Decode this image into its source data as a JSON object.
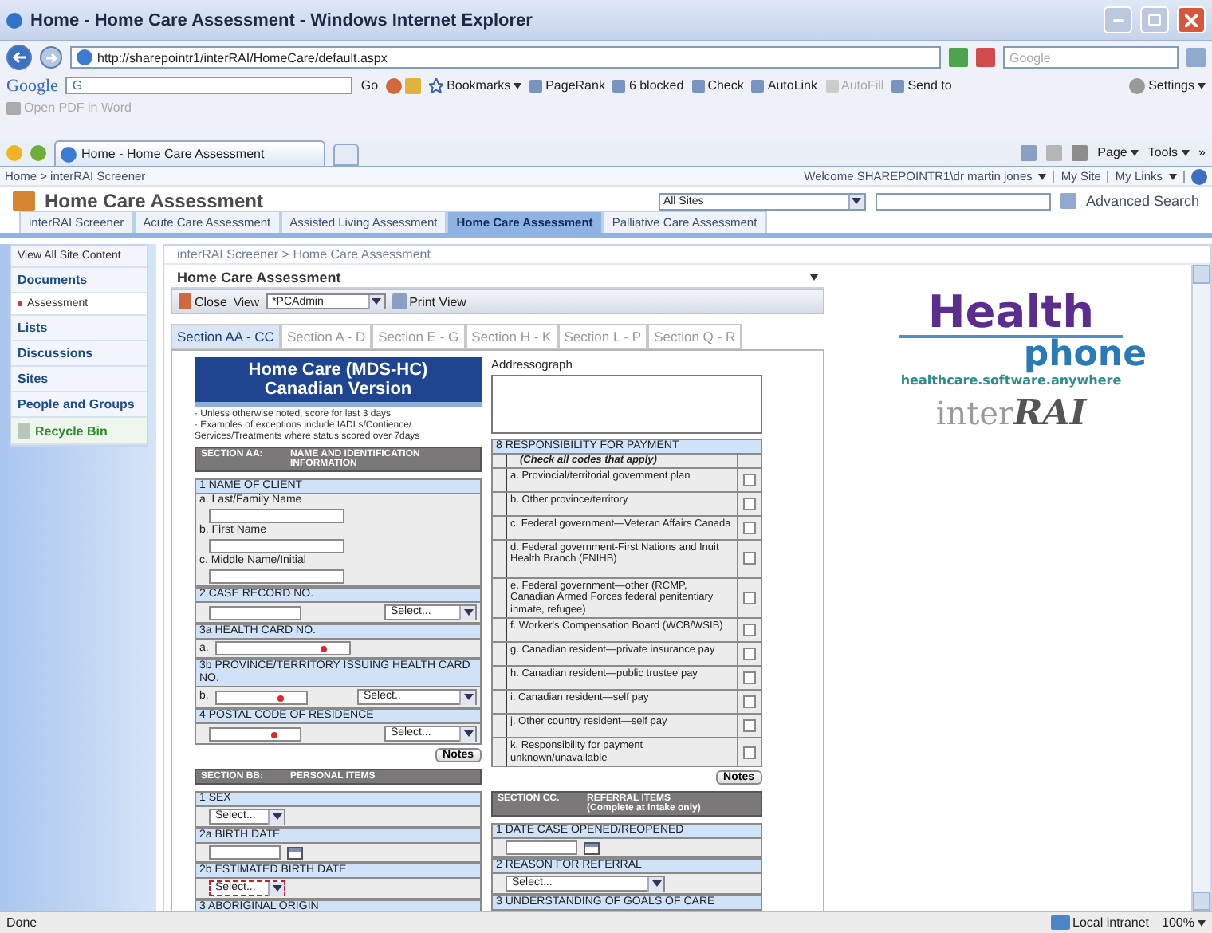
{
  "window": {
    "title": "Home - Home Care Assessment - Windows Internet Explorer"
  },
  "address_bar": {
    "url": "http://sharepointr1/interRAI/HomeCare/default.aspx",
    "search_placeholder": "Google"
  },
  "google_toolbar": {
    "logo": "Google",
    "field_logo": "G",
    "items": [
      {
        "kind": "text",
        "label": "Go",
        "disabled": false
      },
      {
        "kind": "icons",
        "disabled": false
      },
      {
        "kind": "menu",
        "label": "Bookmarks",
        "disabled": false
      },
      {
        "kind": "pagerank",
        "label": "PageRank",
        "disabled": false
      },
      {
        "kind": "blocked",
        "label": "6 blocked",
        "disabled": false
      },
      {
        "kind": "check",
        "label": "Check",
        "disabled": false
      },
      {
        "kind": "autolink",
        "label": "AutoLink",
        "disabled": false
      },
      {
        "kind": "autofill",
        "label": "AutoFill",
        "disabled": true
      },
      {
        "kind": "send",
        "label": "Send to",
        "disabled": false
      }
    ],
    "settings": "Settings"
  },
  "pdf_toolbar": {
    "label": "Open PDF in Word"
  },
  "browser_tab": {
    "title": "Home - Home Care Assessment"
  },
  "command_bar": {
    "page": "Page",
    "tools": "Tools",
    "overflow": "»"
  },
  "site": {
    "breadcrumb": "Home > interRAI Screener",
    "welcome": "Welcome SHAREPOINTR1\\dr martin jones",
    "my_site": "My Site",
    "my_links": "My Links",
    "title": "Home Care Assessment",
    "scope": "All Sites",
    "advanced_search": "Advanced Search",
    "nav": [
      {
        "label": "interRAI Screener",
        "selected": false
      },
      {
        "label": "Acute Care Assessment",
        "selected": false
      },
      {
        "label": "Assisted Living Assessment",
        "selected": false
      },
      {
        "label": "Home Care Assessment",
        "selected": true
      },
      {
        "label": "Palliative Care Assessment",
        "selected": false
      }
    ]
  },
  "sidebar": {
    "view_all": "View All Site Content",
    "sections": [
      {
        "heading": "Documents",
        "items": [
          "Assessment"
        ]
      },
      {
        "heading": "Lists"
      },
      {
        "heading": "Discussions"
      },
      {
        "heading": "Sites"
      },
      {
        "heading": "People and Groups"
      }
    ],
    "recycle_bin": "Recycle Bin"
  },
  "web_part": {
    "breadcrumb": "interRAI Screener > Home Care Assessment",
    "title": "Home Care Assessment",
    "close": "Close",
    "view_label": "View",
    "view_value": "*PCAdmin",
    "print_view": "Print View"
  },
  "form": {
    "tabs": [
      {
        "label": "Section AA - CC",
        "selected": true
      },
      {
        "label": "Section A - D",
        "selected": false
      },
      {
        "label": "Section E - G",
        "selected": false
      },
      {
        "label": "Section H - K",
        "selected": false
      },
      {
        "label": "Section L - P",
        "selected": false
      },
      {
        "label": "Section Q - R",
        "selected": false
      }
    ],
    "left": [
      {
        "kind": "banner",
        "lines": [
          "Home Care (MDS-HC)",
          "Canadian Version"
        ]
      },
      {
        "kind": "bullets",
        "items": [
          "· Unless otherwise noted, score for last 3 days",
          "· Examples of exceptions include IADLs/Contience/ Services/Treatments where status scored over 7days"
        ]
      },
      {
        "kind": "section",
        "code": "SECTION AA:",
        "title": "NAME AND IDENTIFICATION INFORMATION"
      },
      {
        "kind": "group",
        "heading": "1 NAME OF CLIENT",
        "rows": [
          {
            "kind": "label",
            "text": "a. Last/Family Name"
          },
          {
            "kind": "text",
            "required": false
          },
          {
            "kind": "label",
            "text": "b. First Name"
          },
          {
            "kind": "text",
            "required": false
          },
          {
            "kind": "label",
            "text": "c. Middle Name/Initial"
          },
          {
            "kind": "text",
            "required": false
          }
        ]
      },
      {
        "kind": "group",
        "heading": "2 CASE RECORD NO.",
        "rows": [
          {
            "kind": "text_select",
            "required": false,
            "select": "Select..."
          }
        ]
      },
      {
        "kind": "group",
        "heading": "3a HEALTH CARD NO.",
        "rows": [
          {
            "kind": "text",
            "prefix": "a.",
            "required": true
          }
        ]
      },
      {
        "kind": "group",
        "heading": "3b PROVINCE/TERRITORY ISSUING HEALTH CARD NO.",
        "rows": [
          {
            "kind": "text_select",
            "prefix": "b.",
            "required": true,
            "select": "Select.."
          }
        ]
      },
      {
        "kind": "group",
        "heading": "4 POSTAL CODE OF RESIDENCE",
        "rows": [
          {
            "kind": "text_select",
            "required": true,
            "select": "Select..."
          }
        ]
      },
      {
        "kind": "notes",
        "label": "Notes"
      },
      {
        "kind": "section",
        "code": "SECTION BB:",
        "title": "PERSONAL ITEMS"
      },
      {
        "kind": "group",
        "heading": "1 SEX",
        "rows": [
          {
            "kind": "select",
            "value": "Select...",
            "invalid": false
          }
        ]
      },
      {
        "kind": "group",
        "heading": "2a BIRTH DATE",
        "rows": [
          {
            "kind": "date"
          }
        ]
      },
      {
        "kind": "group",
        "heading": "2b ESTIMATED BIRTH DATE",
        "rows": [
          {
            "kind": "select",
            "value": "Select...",
            "invalid": true
          }
        ]
      },
      {
        "kind": "group",
        "heading": "3 ABORIGINAL ORIGIN"
      }
    ],
    "right": [
      {
        "kind": "addressograph",
        "label": "Addressograph"
      },
      {
        "kind": "checklist",
        "heading": "8 RESPONSIBILITY FOR PAYMENT",
        "subheading": "(Check all codes that apply)",
        "rows": [
          {
            "label": "a. Provincial/territorial government plan",
            "checked": false
          },
          {
            "label": "b. Other province/territory",
            "checked": false
          },
          {
            "label": "c. Federal government—Veteran Affairs Canada",
            "checked": false
          },
          {
            "label": "d. Federal government-First Nations and Inuit Health Branch (FNIHB)",
            "checked": false
          },
          {
            "label": "e. Federal government—other (RCMP, Canadian Armed Forces federal penitentiary inmate, refugee)",
            "checked": false
          },
          {
            "label": "f. Worker's Compensation Board (WCB/WSIB)",
            "checked": false
          },
          {
            "label": "g. Canadian resident—private insurance pay",
            "checked": false
          },
          {
            "label": "h. Canadian resident—public trustee pay",
            "checked": false
          },
          {
            "label": "i. Canadian resident—self pay",
            "checked": false
          },
          {
            "label": "j. Other country resident—self pay",
            "checked": false
          },
          {
            "label": "k. Responsibility for payment unknown/unavailable",
            "checked": false
          }
        ]
      },
      {
        "kind": "notes",
        "label": "Notes"
      },
      {
        "kind": "section",
        "code": "SECTION CC.",
        "title": "REFERRAL ITEMS",
        "subtitle": "(Complete at Intake only)"
      },
      {
        "kind": "group",
        "heading": "1 DATE CASE OPENED/REOPENED",
        "rows": [
          {
            "kind": "date"
          }
        ]
      },
      {
        "kind": "group",
        "heading": "2 REASON FOR REFERRAL",
        "rows": [
          {
            "kind": "select",
            "value": "Select...",
            "invalid": false
          }
        ]
      },
      {
        "kind": "group",
        "heading": "3 UNDERSTANDING OF GOALS OF CARE"
      }
    ]
  },
  "logo": {
    "health": "Health",
    "phone": "phone",
    "tagline": "healthcare.software.anywhere",
    "inter": "inter",
    "rai": "RAI"
  },
  "status_bar": {
    "status": "Done",
    "zone": "Local intranet",
    "zoom": "100%"
  }
}
